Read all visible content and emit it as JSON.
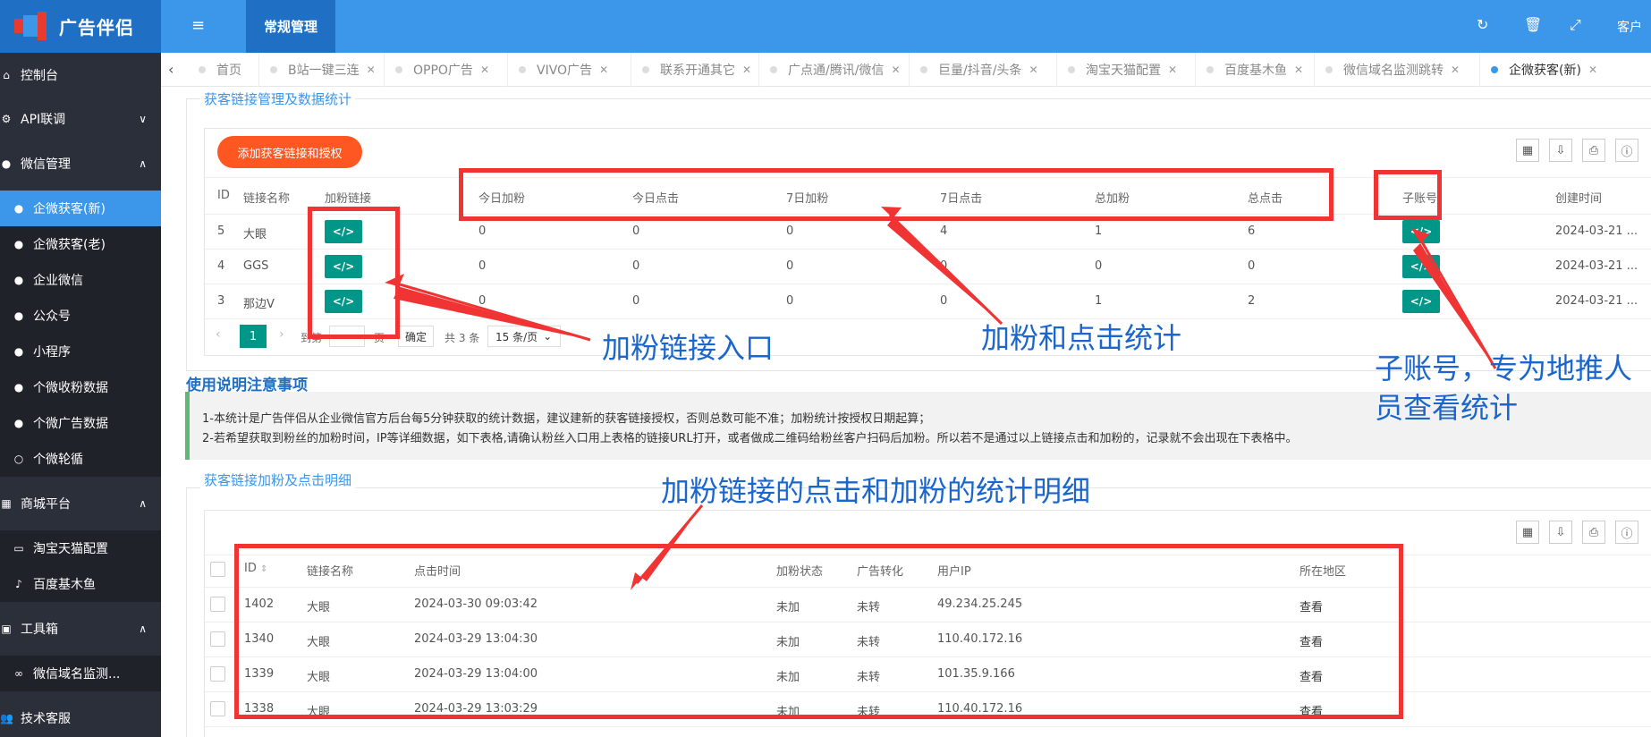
{
  "app": {
    "title": "广告伴侣",
    "nav_tab": "常规管理",
    "customer_label": "客户"
  },
  "sidebar": {
    "items": [
      {
        "label": "控制台"
      },
      {
        "label": "API联调"
      },
      {
        "label": "微信管理"
      },
      {
        "label": "企微获客(新)"
      },
      {
        "label": "企微获客(老)"
      },
      {
        "label": "企业微信"
      },
      {
        "label": "公众号"
      },
      {
        "label": "小程序"
      },
      {
        "label": "个微收粉数据"
      },
      {
        "label": "个微广告数据"
      },
      {
        "label": "个微轮循"
      },
      {
        "label": "商城平台"
      },
      {
        "label": "淘宝天猫配置"
      },
      {
        "label": "百度基木鱼"
      },
      {
        "label": "工具箱"
      },
      {
        "label": "微信域名监测..."
      },
      {
        "label": "技术客服"
      }
    ]
  },
  "tabs": [
    {
      "label": "首页"
    },
    {
      "label": "B站一键三连"
    },
    {
      "label": "OPPO广告"
    },
    {
      "label": "VIVO广告"
    },
    {
      "label": "联系开通其它"
    },
    {
      "label": "广点通/腾讯/微信"
    },
    {
      "label": "巨量/抖音/头条"
    },
    {
      "label": "淘宝天猫配置"
    },
    {
      "label": "百度基木鱼"
    },
    {
      "label": "微信域名监测跳转"
    },
    {
      "label": "企微获客(新)"
    }
  ],
  "section1": {
    "legend": "获客链接管理及数据统计",
    "add_button": "添加获客链接和授权",
    "columns": [
      "ID",
      "链接名称",
      "加粉链接",
      "今日加粉",
      "今日点击",
      "7日加粉",
      "7日点击",
      "总加粉",
      "总点击",
      "子账号",
      "创建时间"
    ],
    "rows": [
      {
        "id": "5",
        "name": "大眼",
        "today_fans": "0",
        "today_clicks": "0",
        "week_fans": "0",
        "week_clicks": "4",
        "total_fans": "1",
        "total_clicks": "6",
        "created": "2024-03-21 ..."
      },
      {
        "id": "4",
        "name": "GGS",
        "today_fans": "0",
        "today_clicks": "0",
        "week_fans": "0",
        "week_clicks": "0",
        "total_fans": "0",
        "total_clicks": "0",
        "created": "2024-03-21 ..."
      },
      {
        "id": "3",
        "name": "那边V",
        "today_fans": "0",
        "today_clicks": "0",
        "week_fans": "0",
        "week_clicks": "0",
        "total_fans": "1",
        "total_clicks": "2",
        "created": "2024-03-21 ..."
      }
    ],
    "code_glyph": "</>",
    "pager": {
      "page": "1",
      "goto": "到第",
      "page_unit": "页",
      "confirm": "确定",
      "total": "共 3 条",
      "per_page": "15 条/页"
    }
  },
  "notes": {
    "title": "使用说明注意事项",
    "line1": "1-本统计是广告伴侣从企业微信官方后台每5分钟获取的统计数据，建议建新的获客链接授权，否则总数可能不准；加粉统计按授权日期起算；",
    "line2": "2-若希望获取到粉丝的加粉时间，IP等详细数据，如下表格,请确认粉丝入口用上表格的链接URL打开，或者做成二维码给粉丝客户扫码后加粉。所以若不是通过以上链接点击和加粉的，记录就不会出现在下表格中。"
  },
  "section2": {
    "legend": "获客链接加粉及点击明细",
    "columns": [
      "ID",
      "链接名称",
      "点击时间",
      "加粉状态",
      "广告转化",
      "用户IP",
      "所在地区"
    ],
    "rows": [
      {
        "id": "1402",
        "name": "大眼",
        "time": "2024-03-30 09:03:42",
        "status": "未加",
        "conv": "未转",
        "ip": "49.234.25.245",
        "region": "查看"
      },
      {
        "id": "1340",
        "name": "大眼",
        "time": "2024-03-29 13:04:30",
        "status": "未加",
        "conv": "未转",
        "ip": "110.40.172.16",
        "region": "查看"
      },
      {
        "id": "1339",
        "name": "大眼",
        "time": "2024-03-29 13:04:00",
        "status": "未加",
        "conv": "未转",
        "ip": "101.35.9.166",
        "region": "查看"
      },
      {
        "id": "1338",
        "name": "大眼",
        "time": "2024-03-29 13:03:29",
        "status": "未加",
        "conv": "未转",
        "ip": "110.40.172.16",
        "region": "查看"
      }
    ]
  },
  "annotations": {
    "fans_link": "加粉链接入口",
    "stats": "加粉和点击统计",
    "subaccount": "子账号，专为地推人员查看统计",
    "detail": "加粉链接的点击和加粉的统计明细"
  },
  "colors": {
    "primary": "#3c96ea",
    "sidebar": "#2b2f3a",
    "accent_button": "#ff5722",
    "code_button": "#009688",
    "annotation_red": "#f03434",
    "annotation_text": "#1a66cc"
  }
}
